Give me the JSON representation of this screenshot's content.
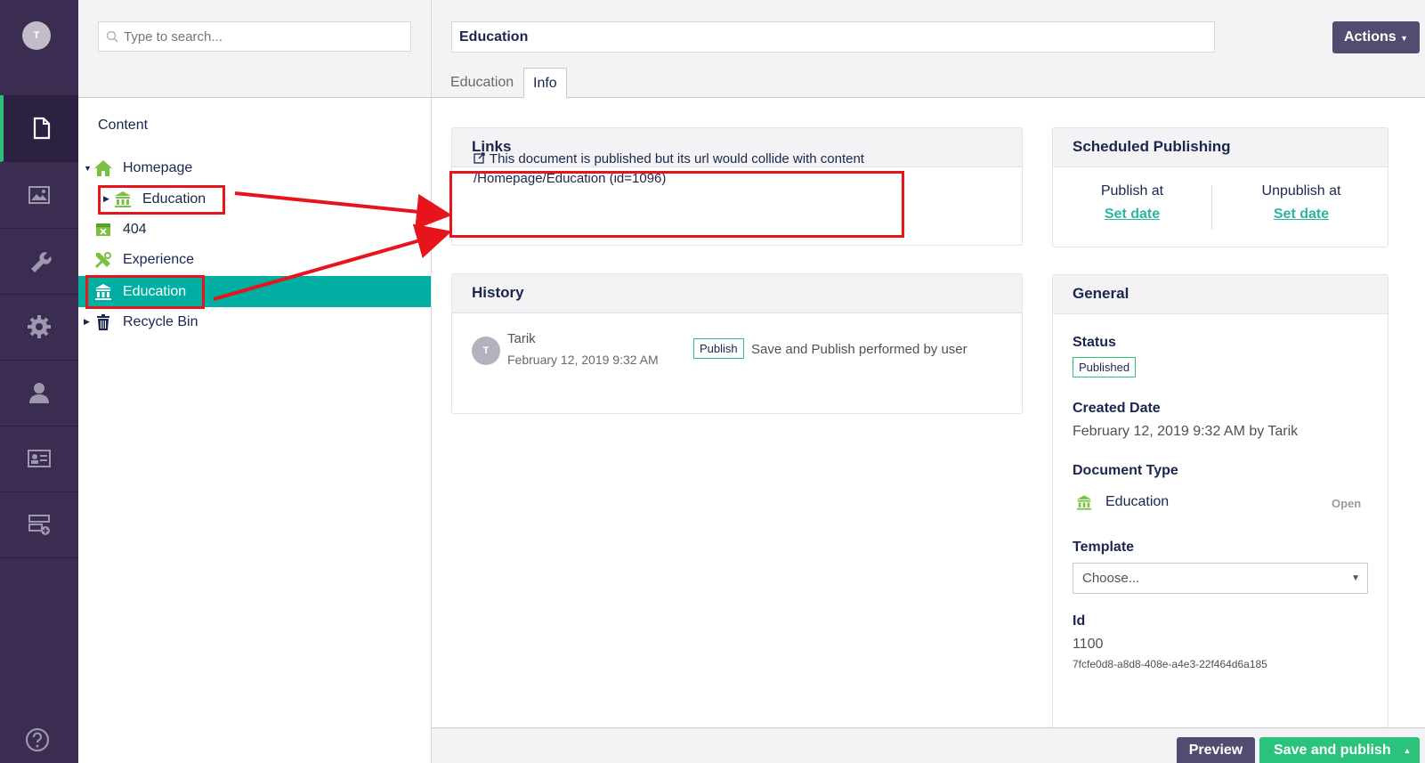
{
  "user": {
    "initial": "T"
  },
  "search": {
    "placeholder": "Type to search..."
  },
  "tree": {
    "title": "Content",
    "nodes": [
      {
        "label": "Homepage",
        "icon": "home-icon"
      },
      {
        "label": "Education",
        "icon": "university-icon"
      },
      {
        "label": "404",
        "icon": "error-page-icon"
      },
      {
        "label": "Experience",
        "icon": "tools-icon"
      },
      {
        "label": "Education",
        "icon": "university-icon"
      },
      {
        "label": "Recycle Bin",
        "icon": "trash-icon"
      }
    ]
  },
  "header": {
    "name": "Education",
    "actions_label": "Actions",
    "tabs": [
      {
        "label": "Education"
      },
      {
        "label": "Info"
      }
    ]
  },
  "links": {
    "title": "Links",
    "message": "This document is published but its url would collide with content /Homepage/Education (id=1096)"
  },
  "history": {
    "title": "History",
    "entry": {
      "initial": "T",
      "user": "Tarik",
      "date": "February 12, 2019 9:32 AM",
      "badge": "Publish",
      "description": "Save and Publish performed by user"
    }
  },
  "scheduled": {
    "title": "Scheduled Publishing",
    "publish_label": "Publish at",
    "publish_link": "Set date",
    "unpublish_label": "Unpublish at",
    "unpublish_link": "Set date"
  },
  "general": {
    "title": "General",
    "status_label": "Status",
    "status_value": "Published",
    "created_label": "Created Date",
    "created_value": "February 12, 2019 9:32 AM by Tarik",
    "doctype_label": "Document Type",
    "doctype_value": "Education",
    "doctype_open": "Open",
    "template_label": "Template",
    "template_value": "Choose...",
    "id_label": "Id",
    "id_value": "1100",
    "guid": "7fcfe0d8-a8d8-408e-a4e3-22f464d6a185"
  },
  "footer": {
    "preview_label": "Preview",
    "save_label": "Save and publish"
  },
  "colors": {
    "nav": "#3b2d52",
    "accent": "#00aea2",
    "success": "#2bc37c",
    "highlight": "#e8141c",
    "button": "#544b71"
  }
}
